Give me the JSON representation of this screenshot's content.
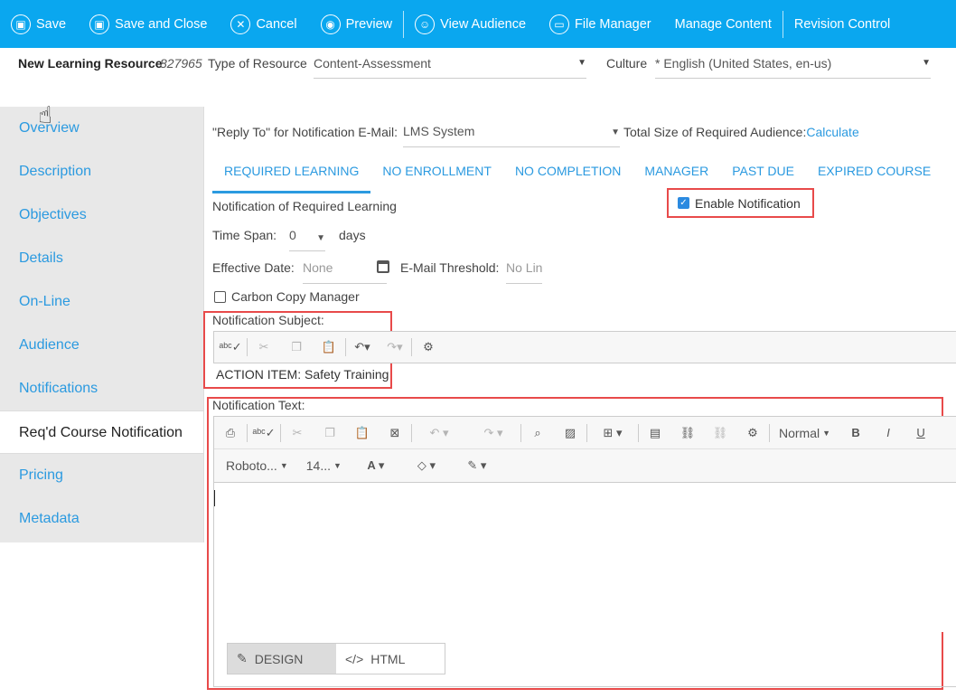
{
  "toolbar": {
    "save": "Save",
    "save_close": "Save and Close",
    "cancel": "Cancel",
    "preview": "Preview",
    "view_audience": "View Audience",
    "file_manager": "File Manager",
    "manage_content": "Manage Content",
    "revision_control": "Revision Control"
  },
  "header": {
    "title": "New Learning Resource",
    "id": "827965",
    "type_label": "Type of Resource",
    "type_value": "Content-Assessment",
    "culture_label": "Culture",
    "culture_value": "* English (United States, en-us)"
  },
  "sidebar": {
    "items": [
      {
        "label": "Overview"
      },
      {
        "label": "Description"
      },
      {
        "label": "Objectives"
      },
      {
        "label": "Details"
      },
      {
        "label": "On-Line"
      },
      {
        "label": "Audience"
      },
      {
        "label": "Notifications"
      },
      {
        "label": "Req'd Course Notification"
      },
      {
        "label": "Pricing"
      },
      {
        "label": "Metadata"
      }
    ],
    "active_index": 7
  },
  "main": {
    "reply_to_label": "\"Reply To\" for Notification E-Mail:",
    "reply_to_value": "LMS System",
    "total_size_label": "Total Size of Required Audience:",
    "calculate_link": "Calculate",
    "tabs": [
      {
        "label": "REQUIRED LEARNING"
      },
      {
        "label": "NO ENROLLMENT"
      },
      {
        "label": "NO COMPLETION"
      },
      {
        "label": "MANAGER"
      },
      {
        "label": "PAST DUE"
      },
      {
        "label": "EXPIRED COURSE"
      }
    ],
    "notif_title": "Notification of Required Learning",
    "enable_label": "Enable Notification",
    "enable_checked": true,
    "time_span_label": "Time Span:",
    "time_span_value": "0",
    "time_span_unit": "days",
    "effective_label": "Effective Date:",
    "effective_placeholder": "None",
    "threshold_label": "E-Mail Threshold:",
    "threshold_placeholder": "No Lin",
    "cc_manager_label": "Carbon Copy Manager",
    "cc_manager_checked": false,
    "subject_label": "Notification Subject:",
    "subject_value": "ACTION ITEM: Safety Training",
    "text_label": "Notification Text:",
    "format_block": "Normal",
    "font_name": "Roboto...",
    "font_size": "14...",
    "mode_design": "DESIGN",
    "mode_html": "HTML"
  },
  "colors": {
    "toolbar_bg": "#0aa7ef",
    "link_blue": "#2b9ae0",
    "highlight_red": "#e84a4a"
  }
}
